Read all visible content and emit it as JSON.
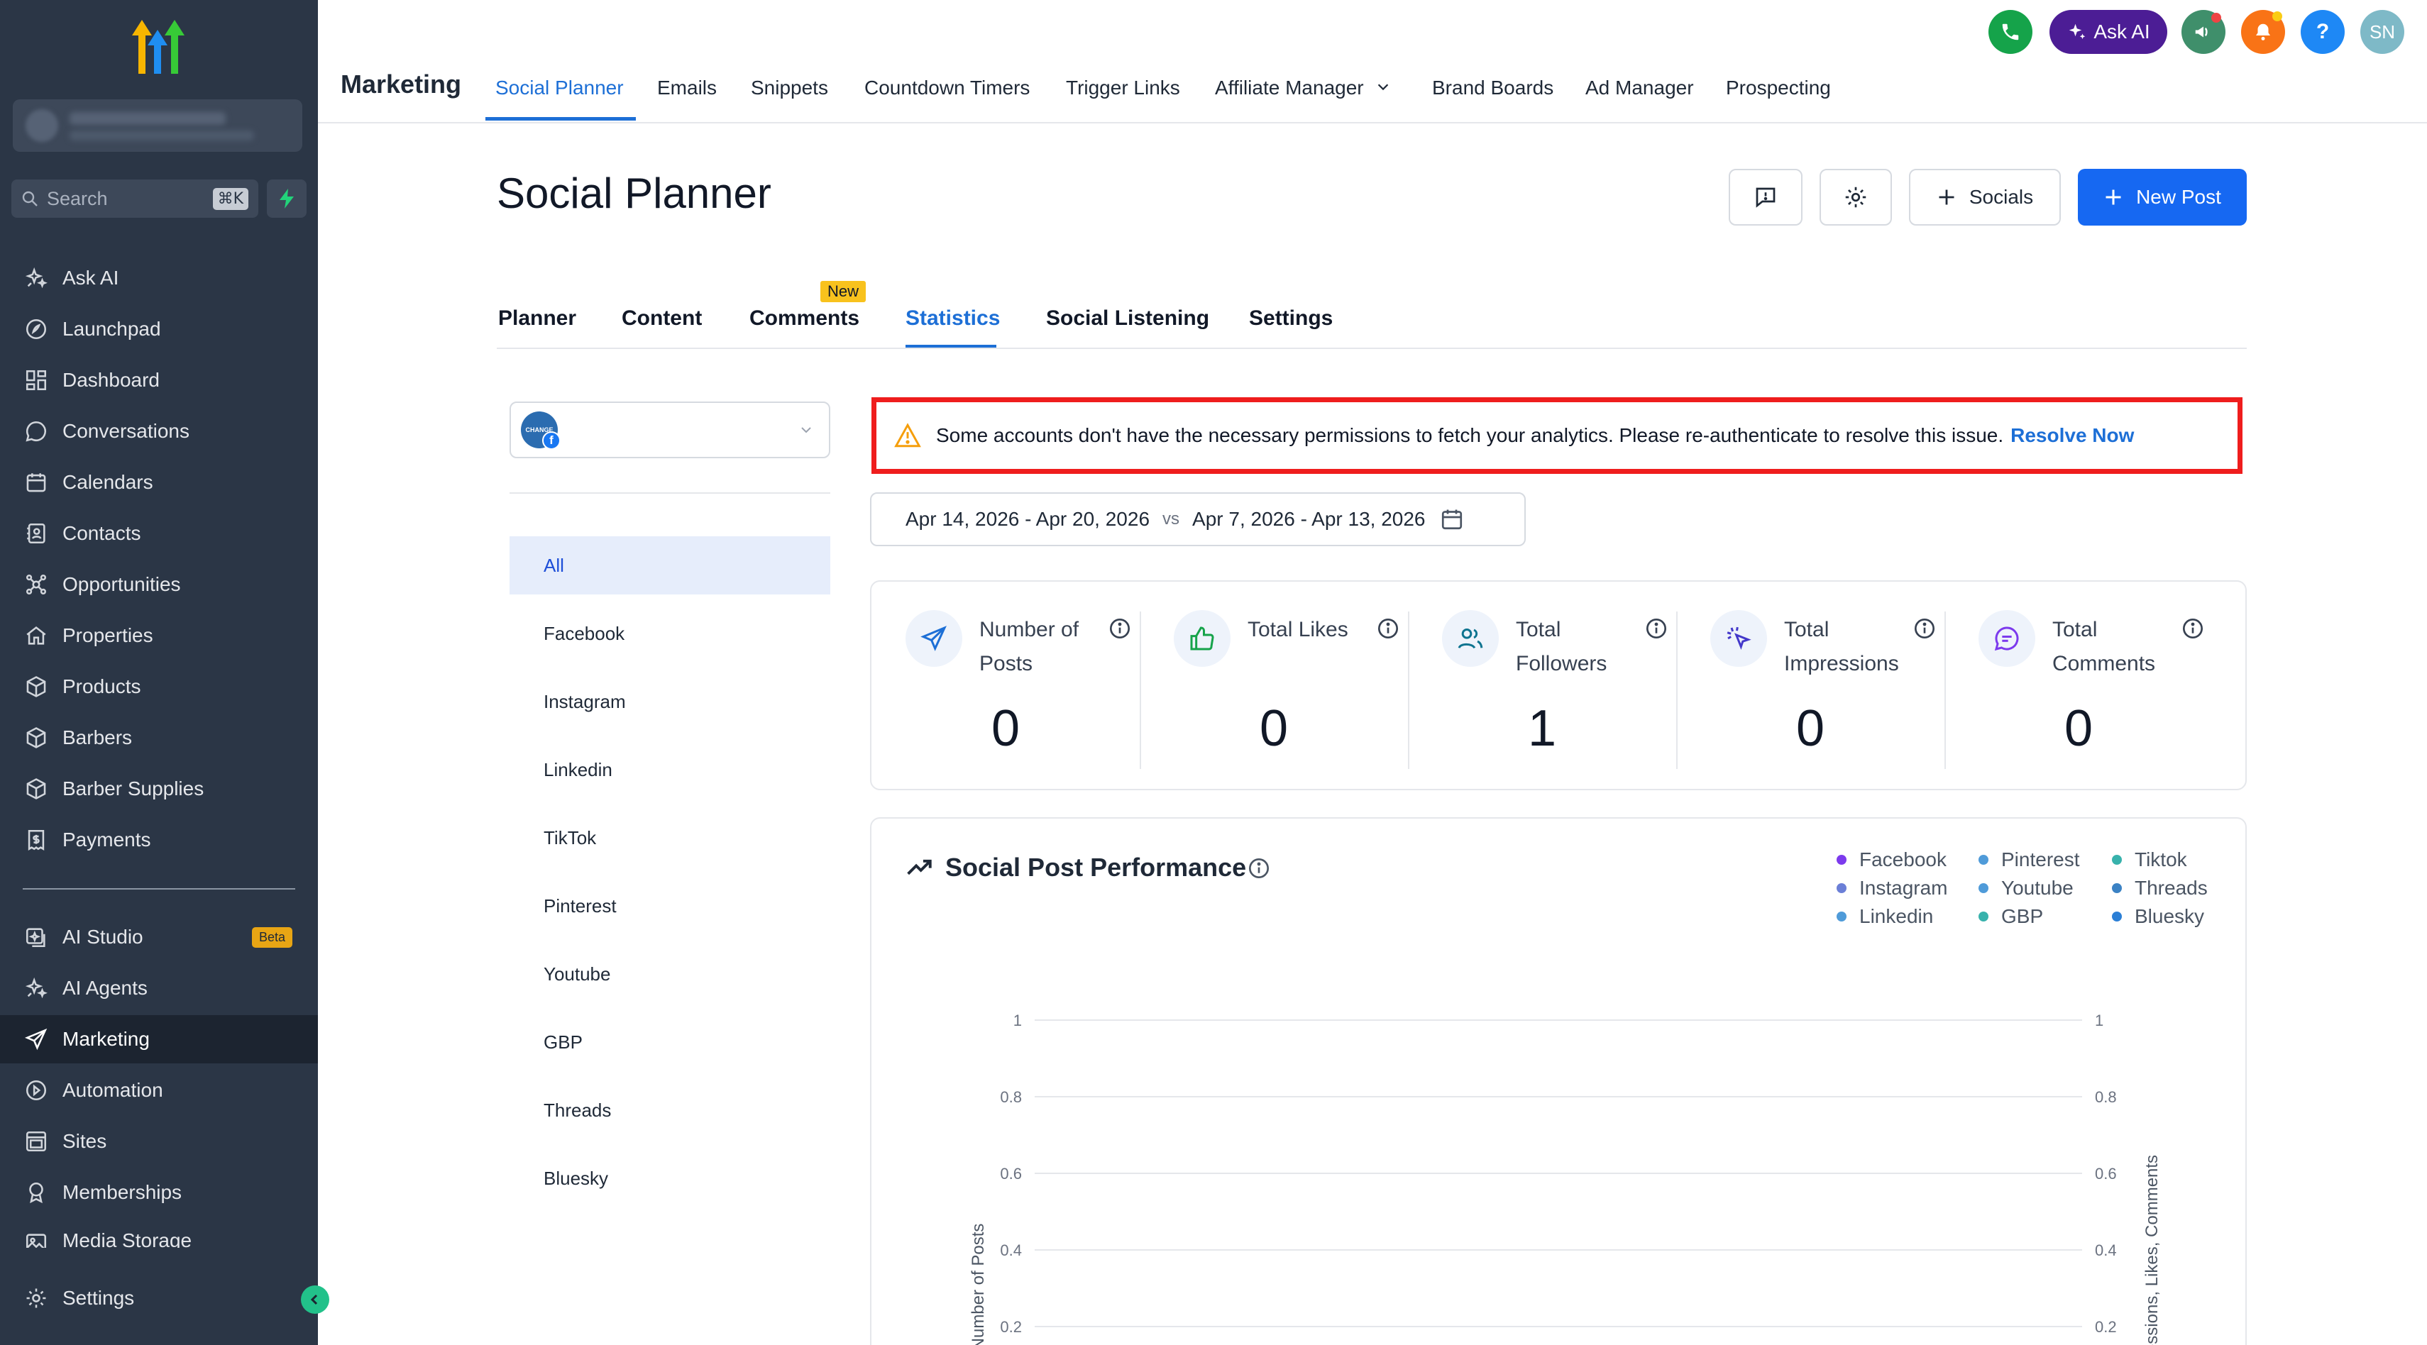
{
  "sidebar": {
    "search": {
      "placeholder": "Search",
      "shortcut": "⌘K"
    },
    "items": [
      {
        "label": "Ask AI",
        "icon": "sparkle-icon"
      },
      {
        "label": "Launchpad",
        "icon": "rocket-icon"
      },
      {
        "label": "Dashboard",
        "icon": "dashboard-icon"
      },
      {
        "label": "Conversations",
        "icon": "chat-icon"
      },
      {
        "label": "Calendars",
        "icon": "calendar-icon"
      },
      {
        "label": "Contacts",
        "icon": "contacts-icon"
      },
      {
        "label": "Opportunities",
        "icon": "opportunities-icon"
      },
      {
        "label": "Properties",
        "icon": "home-icon"
      },
      {
        "label": "Products",
        "icon": "box-icon"
      },
      {
        "label": "Barbers",
        "icon": "box-icon"
      },
      {
        "label": "Barber Supplies",
        "icon": "box-icon"
      },
      {
        "label": "Payments",
        "icon": "receipt-icon"
      }
    ],
    "items2": [
      {
        "label": "AI Studio",
        "icon": "ai-studio-icon",
        "badge": "Beta"
      },
      {
        "label": "AI Agents",
        "icon": "sparkle-icon"
      },
      {
        "label": "Marketing",
        "icon": "send-icon",
        "active": true
      },
      {
        "label": "Automation",
        "icon": "automation-icon"
      },
      {
        "label": "Sites",
        "icon": "sites-icon"
      },
      {
        "label": "Memberships",
        "icon": "award-icon"
      },
      {
        "label": "Media Storage",
        "icon": "image-icon"
      }
    ],
    "settings": {
      "label": "Settings",
      "icon": "gear-icon"
    }
  },
  "topbar": {
    "title": "Marketing",
    "tabs": [
      "Social Planner",
      "Emails",
      "Snippets",
      "Countdown Timers",
      "Trigger Links",
      "Affiliate Manager",
      "Brand Boards",
      "Ad Manager",
      "Prospecting"
    ],
    "ask_ai": "Ask AI",
    "avatar": "SN",
    "help": "?"
  },
  "page": {
    "title": "Social Planner",
    "socials_btn": "Socials",
    "new_post_btn": "New Post",
    "tabs": [
      "Planner",
      "Content",
      "Comments",
      "Statistics",
      "Social Listening",
      "Settings"
    ],
    "new_badge": "New",
    "active_tab": "Statistics"
  },
  "filters": {
    "platforms": [
      "All",
      "Facebook",
      "Instagram",
      "Linkedin",
      "TikTok",
      "Pinterest",
      "Youtube",
      "GBP",
      "Threads",
      "Bluesky"
    ],
    "selected": "All"
  },
  "warning": {
    "text": "Some accounts don't have the necessary permissions to fetch your analytics. Please re-authenticate to resolve this issue.",
    "link": "Resolve Now"
  },
  "date_range": {
    "current": "Apr 14, 2026 - Apr 20, 2026",
    "vs": "vs",
    "previous": "Apr 7, 2026 - Apr 13, 2026"
  },
  "stats": [
    {
      "label": "Number of Posts",
      "value": "0",
      "icon": "send-icon"
    },
    {
      "label": "Total Likes",
      "value": "0",
      "icon": "thumbs-up-icon"
    },
    {
      "label": "Total Followers",
      "value": "1",
      "icon": "users-icon"
    },
    {
      "label": "Total Impressions",
      "value": "0",
      "icon": "cursor-click-icon"
    },
    {
      "label": "Total Comments",
      "value": "0",
      "icon": "comment-icon"
    }
  ],
  "chart_data": {
    "type": "line",
    "title": "Social Post Performance",
    "ylabel": "Number of Posts",
    "y2label": "Impressions, Likes, Comments",
    "ylim": [
      0,
      1
    ],
    "y_ticks": [
      "1",
      "0.8",
      "0.6",
      "0.4",
      "0.2"
    ],
    "y2_ticks": [
      "1",
      "0.8",
      "0.6",
      "0.4",
      "0.2"
    ],
    "grid": true,
    "legend": [
      {
        "name": "Facebook",
        "color": "#7c3aed"
      },
      {
        "name": "Pinterest",
        "color": "#4f9bd9"
      },
      {
        "name": "Tiktok",
        "color": "#38b2ac"
      },
      {
        "name": "Instagram",
        "color": "#6b7fd7"
      },
      {
        "name": "Youtube",
        "color": "#4f9bd9"
      },
      {
        "name": "Threads",
        "color": "#3b82c4"
      },
      {
        "name": "Linkedin",
        "color": "#4f9bd9"
      },
      {
        "name": "GBP",
        "color": "#38b2ac"
      },
      {
        "name": "Bluesky",
        "color": "#2b7fd6"
      }
    ],
    "legend_position": "top-right",
    "series": []
  },
  "colors": {
    "sidebar_bg": "#2b3646",
    "accent": "#1668f2",
    "warning_border": "#ef1d1d"
  }
}
